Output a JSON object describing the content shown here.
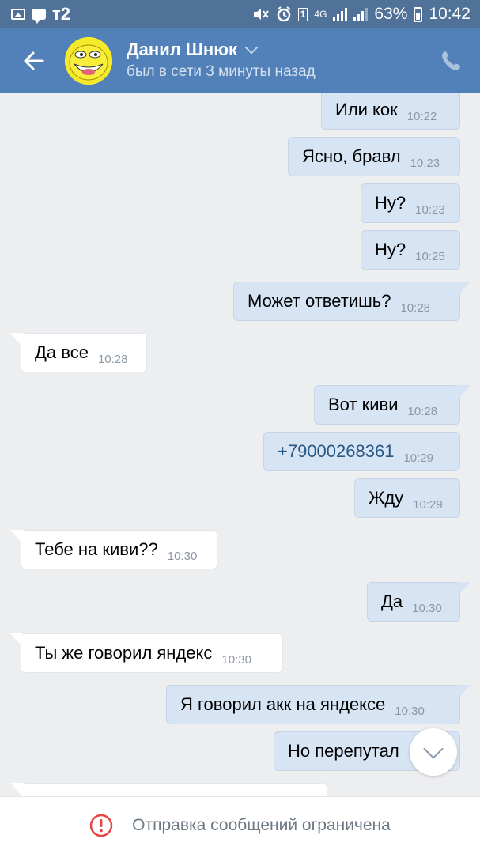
{
  "status_bar": {
    "carrier": "т2",
    "network": "4G",
    "battery": "63%",
    "time": "10:42",
    "notification_count": "1"
  },
  "header": {
    "contact_name": "Данил Шнюк",
    "status": "был в сети 3 минуты назад"
  },
  "messages": [
    {
      "dir": "out",
      "text": "Или кок",
      "time": "10:22"
    },
    {
      "dir": "out",
      "text": "Ясно, бравл",
      "time": "10:23"
    },
    {
      "dir": "out",
      "text": "Ну?",
      "time": "10:23"
    },
    {
      "dir": "out",
      "text": "Ну?",
      "time": "10:25"
    },
    {
      "dir": "out",
      "text": "Может ответишь?",
      "time": "10:28"
    },
    {
      "dir": "in",
      "text": "Да все",
      "time": "10:28"
    },
    {
      "dir": "out",
      "text": "Вот киви",
      "time": "10:28"
    },
    {
      "dir": "out",
      "text": "+79000268361",
      "time": "10:29",
      "link": true
    },
    {
      "dir": "out",
      "text": "Жду",
      "time": "10:29"
    },
    {
      "dir": "in",
      "text": "Тебе на киви??",
      "time": "10:30"
    },
    {
      "dir": "out",
      "text": "Да",
      "time": "10:30"
    },
    {
      "dir": "in",
      "text": "Ты же говорил яндекс",
      "time": "10:30"
    },
    {
      "dir": "out",
      "text": "Я говорил акк на яндексе",
      "time": "10:30"
    },
    {
      "dir": "out",
      "text": "Но перепутал",
      "time": ""
    }
  ],
  "footer": {
    "restricted_text": "Отправка сообщений ограничена"
  },
  "colors": {
    "header": "#5181b8",
    "statusbar": "#507299",
    "background": "#edeef0",
    "outgoing_bubble": "#d7e4f4",
    "incoming_bubble": "#ffffff",
    "warning": "#e64646",
    "link": "#2a5885"
  }
}
